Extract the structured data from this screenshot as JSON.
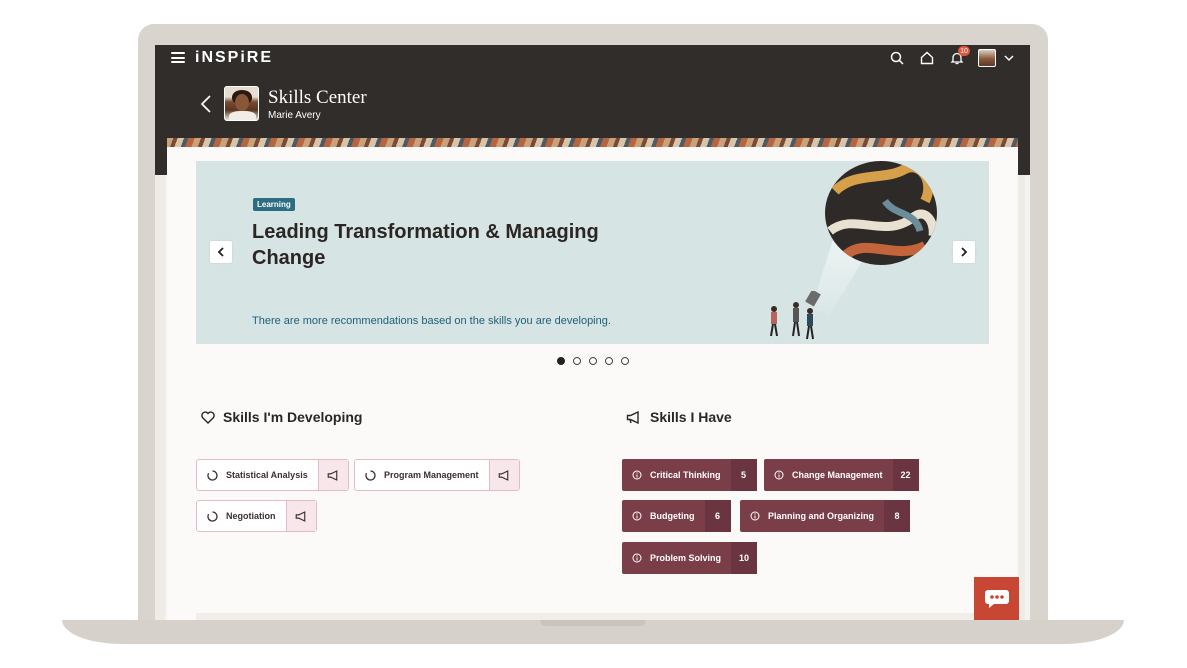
{
  "app": {
    "brand": "iNSPiRE",
    "notification_count": "10"
  },
  "header": {
    "title": "Skills Center",
    "subtitle": "Marie Avery"
  },
  "banner": {
    "tag": "Learning",
    "title": "Leading Transformation & Managing Change",
    "text": "There are more recommendations based on the skills you are developing."
  },
  "carousel": {
    "count": 5,
    "active_index": 0
  },
  "developing": {
    "title": "Skills I'm Developing",
    "skills": [
      "Statistical Analysis",
      "Program Management",
      "Negotiation"
    ]
  },
  "have": {
    "title": "Skills I Have",
    "skills": [
      {
        "label": "Critical Thinking",
        "count": "5"
      },
      {
        "label": "Change Management",
        "count": "22"
      },
      {
        "label": "Budgeting",
        "count": "6"
      },
      {
        "label": "Planning and Organizing",
        "count": "8"
      },
      {
        "label": "Problem Solving",
        "count": "10"
      }
    ]
  },
  "colors": {
    "topbar": "#312d2a",
    "accent": "#7a3e49",
    "tag": "#2c6d82",
    "chat": "#c74634",
    "badge": "#e0573f"
  }
}
